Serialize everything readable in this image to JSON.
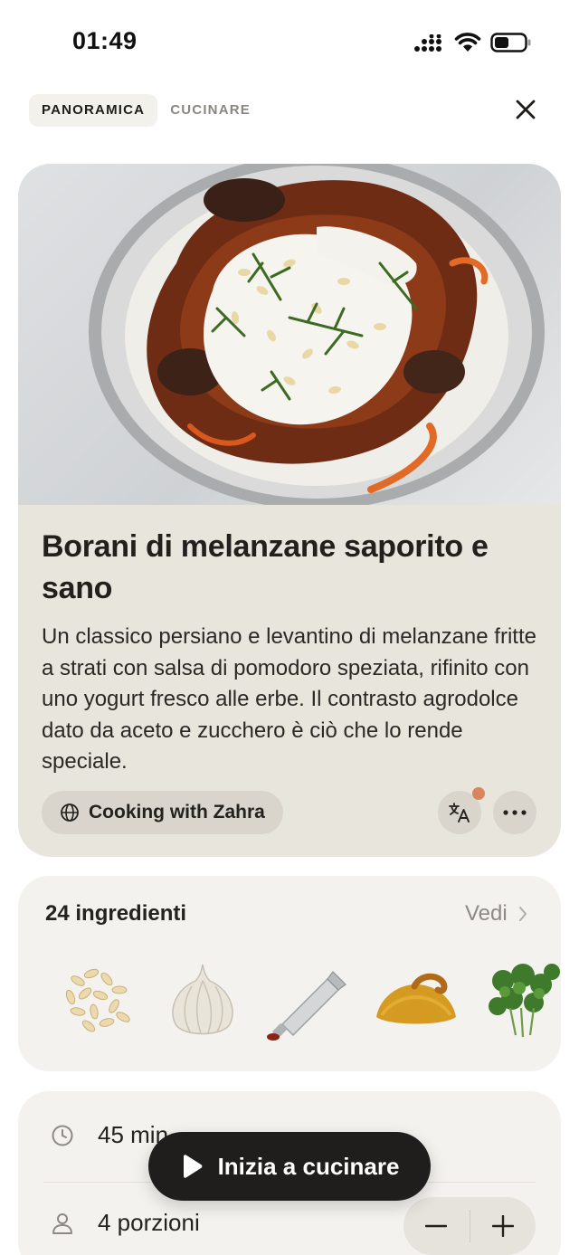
{
  "status_bar": {
    "time": "01:49"
  },
  "tabs": [
    {
      "label": "PANORAMICA",
      "active": true
    },
    {
      "label": "CUCINARE",
      "active": false
    }
  ],
  "recipe": {
    "title": "Borani di melanzane saporito e sano",
    "description": "Un classico persiano e levantino di melanzane fritte a strati con salsa di pomodoro speziata, rifinito con uno yogurt fresco alle erbe. Il contrasto agrodolce dato da aceto e zucchero è ciò che lo rende speciale.",
    "source": "Cooking with Zahra"
  },
  "ingredients": {
    "count_label": "24 ingredienti",
    "see_all_label": "Vedi",
    "thumbnails": [
      "pine-nuts",
      "garlic",
      "tomato-paste-tube",
      "turmeric",
      "cilantro"
    ]
  },
  "info": {
    "time_label": "45 min",
    "servings_label": "4 porzioni"
  },
  "start_button": {
    "label": "Inizia a cucinare"
  },
  "colors": {
    "card_beige": "#e8e5dd",
    "card_light": "#f4f2ee",
    "button_dark": "#1f1e1c",
    "accent_dot": "#d98660"
  }
}
